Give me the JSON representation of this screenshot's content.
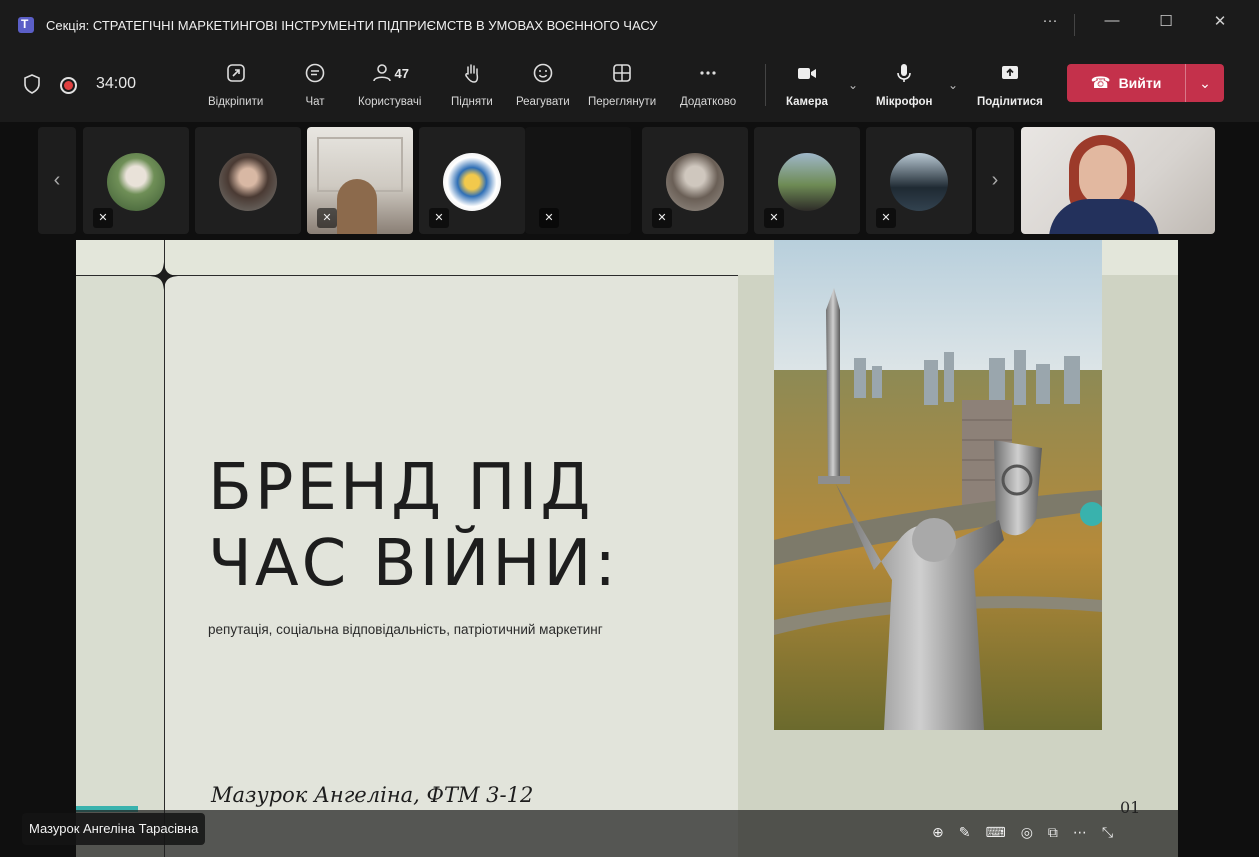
{
  "window": {
    "title": "Секція: СТРАТЕГІЧНІ МАРКЕТИНГОВІ ІНСТРУМЕНТИ ПІДПРИЄМСТВ В УМОВАХ ВОЄННОГО ЧАСУ",
    "more_label": "···",
    "minimize_label": "—",
    "maximize_label": "☐",
    "close_label": "✕"
  },
  "toolbar": {
    "timer": "34:00",
    "unpin_label": "Відкріпити",
    "chat_label": "Чат",
    "people_label": "Користувачі",
    "people_count": "47",
    "raise_label": "Підняти",
    "react_label": "Реагувати",
    "view_label": "Переглянути",
    "more_label": "Додатково",
    "camera_label": "Камера",
    "mic_label": "Мікрофон",
    "share_label": "Поділитися",
    "leave_label": "Вийти"
  },
  "slide": {
    "title": "БРЕНД ПІД ЧАС ВІЙНИ:",
    "subtitle": "репутація, соціальна відповідальність, патріотичний маркетинг",
    "author": "Мазурок Ангеліна, ФТМ 3-12",
    "page_number": "01"
  },
  "presenter": {
    "name": "Мазурок Ангеліна Тарасівна"
  },
  "colors": {
    "leave": "#c4314b",
    "accent_teal": "#39b2ad",
    "slide_bg": "#e2e4db"
  }
}
